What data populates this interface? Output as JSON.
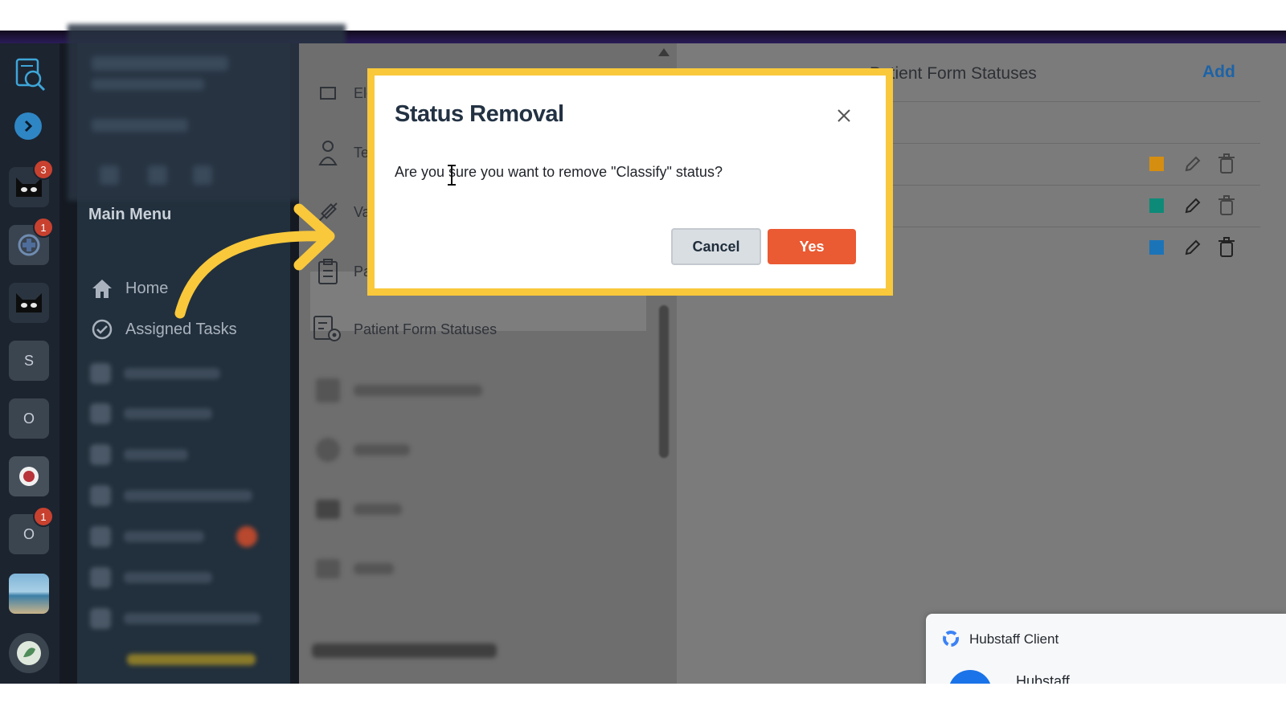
{
  "app": {
    "rail_badges": [
      "3",
      "1",
      "1"
    ],
    "rail_letters": [
      "S",
      "O",
      "O"
    ]
  },
  "sidebar": {
    "main_menu_title": "Main Menu",
    "items": [
      {
        "label": "Home",
        "icon": "home-icon"
      },
      {
        "label": "Assigned Tasks",
        "icon": "check-circle-icon"
      }
    ]
  },
  "settings_list": {
    "items": [
      {
        "label": "Ele",
        "icon": "wrench-icon"
      },
      {
        "label": "Te",
        "icon": "person-icon"
      },
      {
        "label": "Va",
        "icon": "syringe-icon"
      },
      {
        "label": "Pa",
        "icon": "clipboard-icon"
      },
      {
        "label": "Patient Form Statuses",
        "icon": "form-settings-icon",
        "selected": true
      }
    ]
  },
  "content": {
    "title": "Patient Form Statuses",
    "add_label": "Add",
    "status_swatches": [
      "#d68e10",
      "#0e8a78",
      "#1b74b8"
    ]
  },
  "modal": {
    "title": "Status Removal",
    "message": "Are you sure you want to remove \"Classify\" status?",
    "cancel_label": "Cancel",
    "yes_label": "Yes",
    "highlight_color": "#f9c83b",
    "yes_color": "#ea5a33"
  },
  "notification": {
    "app_name": "Hubstaff Client",
    "subtitle": "Hubstaff"
  }
}
